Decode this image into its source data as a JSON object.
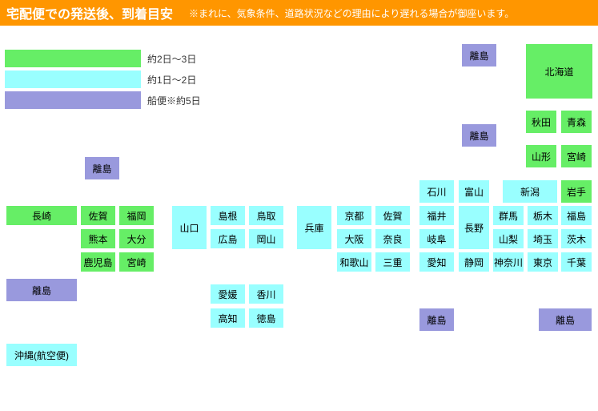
{
  "header": {
    "title": "宅配便での発送後、到着目安",
    "note": "※まれに、気象条件、道路状況などの理由により遅れる場合が御座います。"
  },
  "legend": {
    "items": [
      {
        "color": "#66ee66",
        "label": "約2日～3日"
      },
      {
        "color": "#99ffff",
        "label": "約1日～2日"
      },
      {
        "color": "#9999dd",
        "label": "船便※約5日"
      }
    ]
  },
  "regions": {
    "hokkaido": "北海道",
    "akita": "秋田",
    "aomori": "青森",
    "yamagata": "山形",
    "miyazaki_t": "宮崎",
    "niigata": "新潟",
    "iwate": "岩手",
    "ishikawa": "石川",
    "toyama": "富山",
    "gunma": "群馬",
    "tochigi": "栃木",
    "fukushima": "福島",
    "fukui": "福井",
    "nagano": "長野",
    "yamanashi": "山梨",
    "saitama": "埼玉",
    "ibaraki": "茨木",
    "gifu": "岐阜",
    "shizuoka": "静岡",
    "kanagawa": "神奈川",
    "tokyo": "東京",
    "chiba": "千葉",
    "aichi": "愛知",
    "kyoto": "京都",
    "saga_c": "佐賀",
    "osaka": "大阪",
    "nara": "奈良",
    "wakayama": "和歌山",
    "mie": "三重",
    "hyogo": "兵庫",
    "shimane": "島根",
    "tottori": "鳥取",
    "hiroshima": "広島",
    "okayama": "岡山",
    "yamaguchi": "山口",
    "ehime": "愛媛",
    "kagawa": "香川",
    "kochi": "高知",
    "tokushima": "徳島",
    "nagasaki": "長崎",
    "saga": "佐賀",
    "fukuoka": "福岡",
    "kumamoto": "熊本",
    "oita": "大分",
    "kagoshima": "鹿児島",
    "miyazaki": "宮崎",
    "okinawa": "沖縄(航空便)",
    "island": "離島"
  },
  "chart_data": {
    "type": "table",
    "title": "宅配便での発送後、到着目安",
    "note": "※まれに、気象条件、道路状況などの理由により遅れる場合が御座います。",
    "categories": {
      "約2日～3日": [
        "北海道",
        "秋田",
        "青森",
        "山形",
        "宮崎",
        "岩手",
        "長崎",
        "佐賀",
        "福岡",
        "熊本",
        "大分",
        "鹿児島",
        "宮崎"
      ],
      "約1日～2日": [
        "新潟",
        "石川",
        "富山",
        "群馬",
        "栃木",
        "福島",
        "福井",
        "長野",
        "山梨",
        "埼玉",
        "茨木",
        "岐阜",
        "静岡",
        "神奈川",
        "東京",
        "千葉",
        "愛知",
        "京都",
        "佐賀",
        "大阪",
        "奈良",
        "和歌山",
        "三重",
        "兵庫",
        "島根",
        "鳥取",
        "広島",
        "岡山",
        "山口",
        "愛媛",
        "香川",
        "高知",
        "徳島",
        "沖縄(航空便)"
      ],
      "船便※約5日": [
        "離島"
      ]
    }
  }
}
